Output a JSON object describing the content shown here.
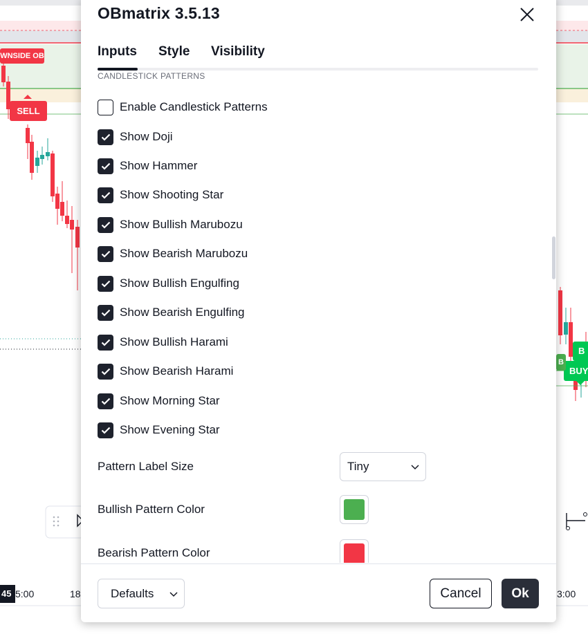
{
  "chart": {
    "labels": {
      "downside_ob": "WNSIDE OB",
      "sell": "SELL",
      "buy_right": "BUY",
      "buy_edge": "B",
      "buy_edge2": "B"
    },
    "axis": {
      "time_badge": "45",
      "times": [
        "5:00",
        "18",
        "3:00"
      ]
    },
    "colors": {
      "up": "#26a69a",
      "down": "#f23645",
      "buy": "#00c853",
      "sell": "#f23645"
    }
  },
  "dialog": {
    "title": "OBmatrix 3.5.13",
    "tabs": [
      "Inputs",
      "Style",
      "Visibility"
    ],
    "active_tab": "Inputs",
    "section_header": "CANDLESTICK PATTERNS",
    "checkboxes": [
      {
        "label": "Enable Candlestick Patterns",
        "checked": false
      },
      {
        "label": "Show Doji",
        "checked": true
      },
      {
        "label": "Show Hammer",
        "checked": true
      },
      {
        "label": "Show Shooting Star",
        "checked": true
      },
      {
        "label": "Show Bullish Marubozu",
        "checked": true
      },
      {
        "label": "Show Bearish Marubozu",
        "checked": true
      },
      {
        "label": "Show Bullish Engulfing",
        "checked": true
      },
      {
        "label": "Show Bearish Engulfing",
        "checked": true
      },
      {
        "label": "Show Bullish Harami",
        "checked": true
      },
      {
        "label": "Show Bearish Harami",
        "checked": true
      },
      {
        "label": "Show Morning Star",
        "checked": true
      },
      {
        "label": "Show Evening Star",
        "checked": true
      }
    ],
    "pattern_label_size": {
      "label": "Pattern Label Size",
      "value": "Tiny"
    },
    "bullish_color": {
      "label": "Bullish Pattern Color",
      "color": "#4caf50"
    },
    "bearish_color": {
      "label": "Bearish Pattern Color",
      "color": "#f23645"
    },
    "footer": {
      "defaults": "Defaults",
      "cancel": "Cancel",
      "ok": "Ok"
    }
  }
}
